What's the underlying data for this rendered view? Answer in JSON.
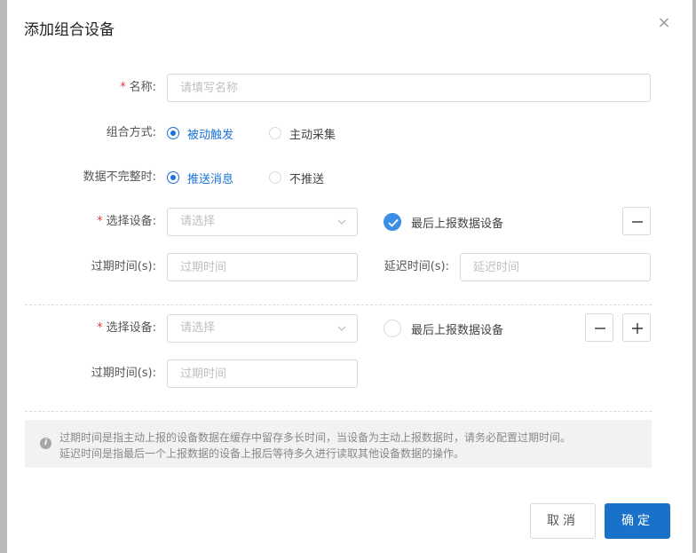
{
  "dialog": {
    "title": "添加组合设备",
    "close_glyph": "×"
  },
  "form": {
    "name_label": "名称:",
    "name_required": "*",
    "name_placeholder": "请填写名称",
    "mode_label": "组合方式:",
    "mode_options": [
      {
        "label": "被动触发",
        "checked": true
      },
      {
        "label": "主动采集",
        "checked": false
      }
    ],
    "incomplete_label": "数据不完整时:",
    "incomplete_options": [
      {
        "label": "推送消息",
        "checked": true
      },
      {
        "label": "不推送",
        "checked": false
      }
    ]
  },
  "device_groups": [
    {
      "device_label": "选择设备:",
      "device_required": "*",
      "device_placeholder": "请选择",
      "last_report_label": "最后上报数据设备",
      "last_report_checked": true,
      "expire_label": "过期时间(s):",
      "expire_placeholder": "过期时间",
      "delay_label": "延迟时间(s):",
      "delay_placeholder": "延迟时间"
    },
    {
      "device_label": "选择设备:",
      "device_required": "*",
      "device_placeholder": "请选择",
      "last_report_label": "最后上报数据设备",
      "last_report_checked": false,
      "expire_label": "过期时间(s):",
      "expire_placeholder": "过期时间"
    }
  ],
  "notice": {
    "line1": "过期时间是指主动上报的设备数据在缓存中留存多长时间，当设备为主动上报数据时，请务必配置过期时间。",
    "line2": "延迟时间是指最后一个上报数据的设备上报后等待多久进行读取其他设备数据的操作。"
  },
  "footer": {
    "cancel_label": "取消",
    "ok_label": "确定"
  },
  "colors": {
    "primary": "#1971c9",
    "required": "#e4393c",
    "check": "#3a8ee6"
  },
  "icons": {
    "close": "close-icon",
    "minus": "minus-icon",
    "plus": "plus-icon",
    "chevron": "chevron-down-icon",
    "info": "info-icon",
    "check": "check-icon"
  }
}
